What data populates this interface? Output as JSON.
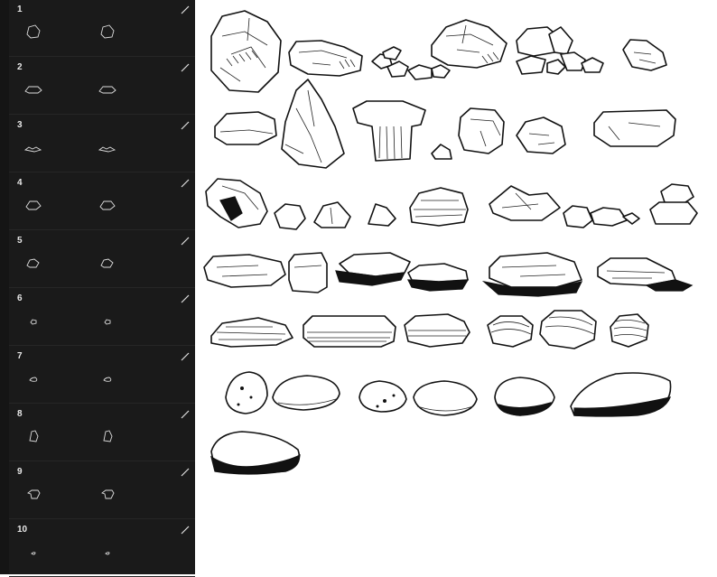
{
  "brush_panel": {
    "rows": [
      {
        "number": "1",
        "icon": "brush-stroke-icon",
        "preview": "rock-boulder-cracked"
      },
      {
        "number": "2",
        "icon": "brush-stroke-icon",
        "preview": "rock-flat-broken"
      },
      {
        "number": "3",
        "icon": "brush-stroke-icon",
        "preview": "rock-rubble-cluster"
      },
      {
        "number": "4",
        "icon": "brush-stroke-icon",
        "preview": "rock-slab-pile"
      },
      {
        "number": "5",
        "icon": "brush-stroke-icon",
        "preview": "rock-stone-group"
      },
      {
        "number": "6",
        "icon": "brush-stroke-icon",
        "preview": "rock-small-stone"
      },
      {
        "number": "7",
        "icon": "brush-stroke-icon",
        "preview": "rock-pebble"
      },
      {
        "number": "8",
        "icon": "brush-stroke-icon",
        "preview": "rock-tall-shard"
      },
      {
        "number": "9",
        "icon": "brush-stroke-icon",
        "preview": "rock-mushroom"
      },
      {
        "number": "10",
        "icon": "brush-stroke-icon",
        "preview": "rock-tiny-pebble"
      }
    ]
  },
  "sheet": {
    "rows": [
      {
        "name": "row-1-craggy-boulders",
        "stones": [
          "boulder-cracked",
          "flat-broken",
          "rubble-cluster",
          "slab-pile",
          "stone-group",
          "small-stone"
        ]
      },
      {
        "name": "row-2-shards",
        "stones": [
          "flat-slab",
          "tall-shard",
          "mushroom-rock",
          "tiny-stone",
          "cube-stone",
          "chunk-stone",
          "wide-slab"
        ]
      },
      {
        "name": "row-3-mixed",
        "stones": [
          "tilted-boulder",
          "small-rock",
          "faceted-rock",
          "tiny-shard",
          "layered-stone",
          "long-shard",
          "pebble-pair",
          "stacked-stones"
        ]
      },
      {
        "name": "row-4-dark-slabs",
        "stones": [
          "flat-oval-slab",
          "square-block",
          "dark-slab",
          "dark-ledge",
          "big-dark-slab",
          "layered-dark-ledge"
        ]
      },
      {
        "name": "row-5-layered",
        "stones": [
          "layered-flat",
          "pillow-slab",
          "round-layered",
          "striped-pebble",
          "striped-oval",
          "ridged-pebble"
        ]
      },
      {
        "name": "row-6-speckled",
        "stones": [
          "speckled-egg",
          "long-pebble",
          "speckled-round",
          "speckled-oval",
          "dark-speckled-oval",
          "large-speckled-pebble"
        ]
      },
      {
        "name": "row-7-single",
        "stones": [
          "dark-speckled-boulder"
        ]
      }
    ]
  }
}
